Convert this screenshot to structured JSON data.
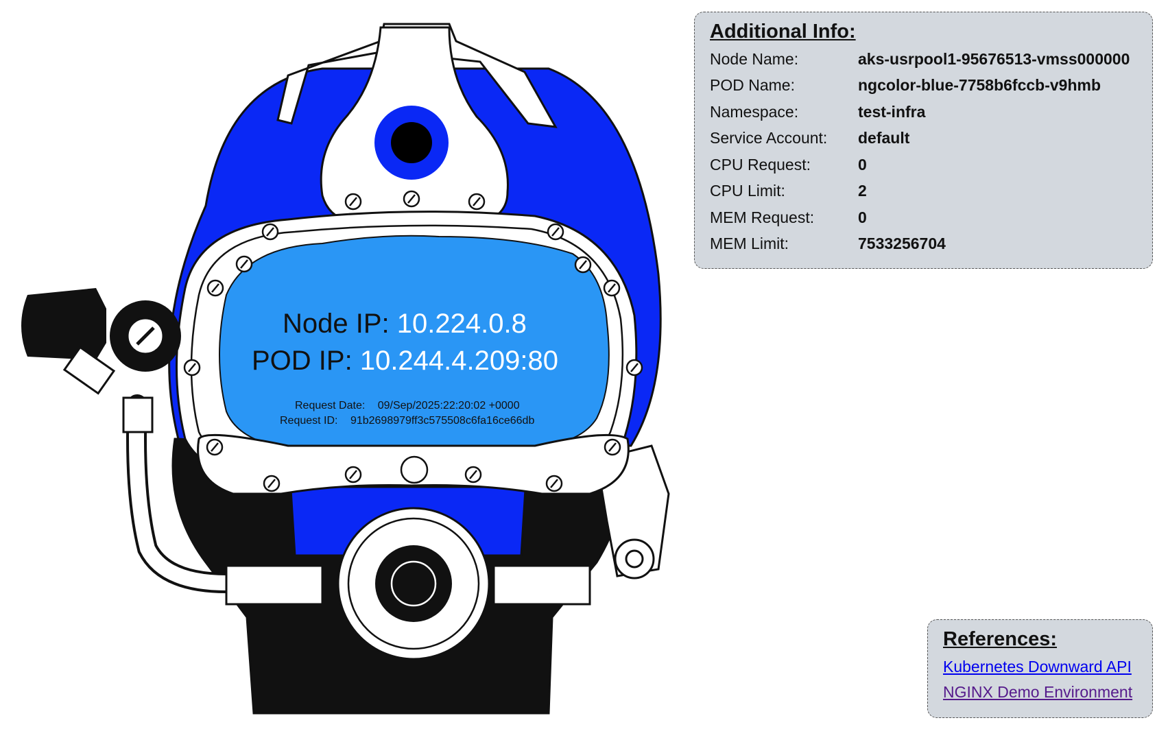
{
  "colors": {
    "helmet_blue": "#0a28f5",
    "visor_blue": "#2a96f5",
    "panel_bg": "#d3d8de"
  },
  "visor": {
    "node_ip_label": "Node IP:",
    "node_ip_value": "10.224.0.8",
    "pod_ip_label": "POD IP:",
    "pod_ip_value": "10.244.4.209:80",
    "request_date_label": "Request Date:",
    "request_date_value": "09/Sep/2025:22:20:02 +0000",
    "request_id_label": "Request ID:",
    "request_id_value": "91b2698979ff3c575508c6fa16ce66db"
  },
  "info": {
    "title": "Additional Info:",
    "rows": [
      {
        "label": "Node Name:",
        "value": "aks-usrpool1-95676513-vmss000000"
      },
      {
        "label": "POD Name:",
        "value": "ngcolor-blue-7758b6fccb-v9hmb"
      },
      {
        "label": "Namespace:",
        "value": "test-infra"
      },
      {
        "label": "Service Account:",
        "value": "default"
      },
      {
        "label": "CPU Request:",
        "value": "0"
      },
      {
        "label": "CPU Limit:",
        "value": "2"
      },
      {
        "label": "MEM Request:",
        "value": "0"
      },
      {
        "label": "MEM Limit:",
        "value": "7533256704"
      }
    ]
  },
  "references": {
    "title": "References:",
    "links": [
      {
        "label": "Kubernetes Downward API"
      },
      {
        "label": "NGINX Demo Environment"
      }
    ]
  }
}
